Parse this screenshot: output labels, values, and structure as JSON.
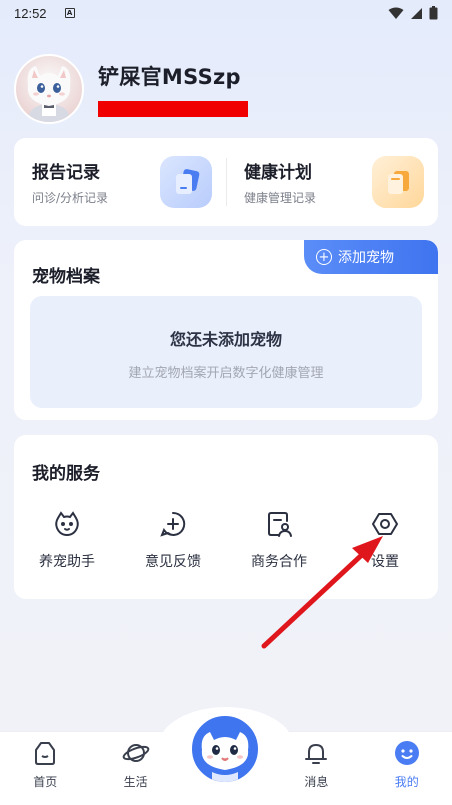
{
  "status_bar": {
    "time": "12:52",
    "notification_icon": "A"
  },
  "profile": {
    "username": "铲屎官MSSzp"
  },
  "records": [
    {
      "title": "报告记录",
      "subtitle": "问诊/分析记录",
      "icon": "report-icon",
      "color": "#b8ccfb"
    },
    {
      "title": "健康计划",
      "subtitle": "健康管理记录",
      "icon": "plan-icon",
      "color": "#ffd79a"
    }
  ],
  "pets": {
    "title": "宠物档案",
    "add_label": "添加宠物",
    "empty_title": "您还未添加宠物",
    "empty_hint": "建立宠物档案开启数字化健康管理"
  },
  "services": {
    "title": "我的服务",
    "items": [
      {
        "label": "养宠助手",
        "icon": "pet-assistant-icon"
      },
      {
        "label": "意见反馈",
        "icon": "feedback-icon"
      },
      {
        "label": "商务合作",
        "icon": "business-icon"
      },
      {
        "label": "设置",
        "icon": "settings-icon"
      }
    ]
  },
  "tabbar": {
    "items": [
      {
        "label": "首页",
        "icon": "home-icon"
      },
      {
        "label": "生活",
        "icon": "planet-icon"
      },
      {
        "label": "",
        "icon": "center-mascot-icon"
      },
      {
        "label": "消息",
        "icon": "bell-icon"
      },
      {
        "label": "我的",
        "icon": "profile-face-icon",
        "active": true
      }
    ]
  },
  "colors": {
    "accent": "#4a7cf3",
    "redaction": "#f00000",
    "annotation": "#e0161d"
  }
}
